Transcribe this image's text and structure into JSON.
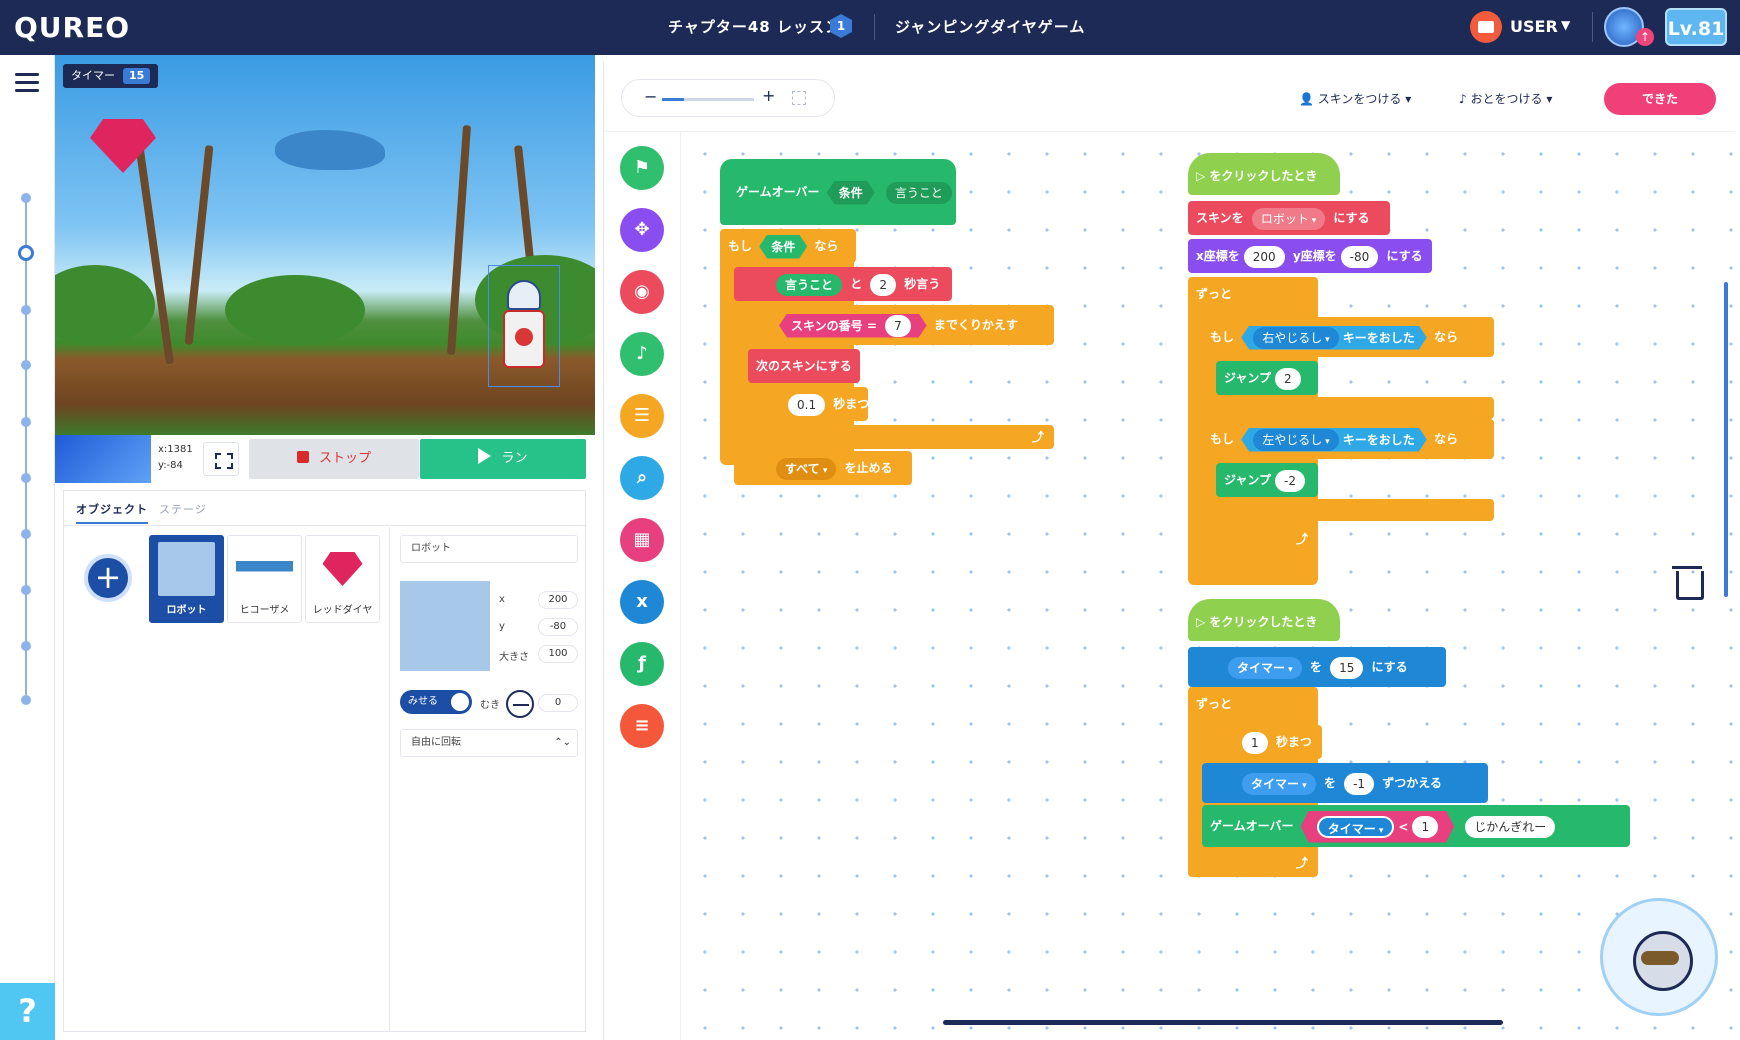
{
  "header": {
    "logo": "QUREO",
    "lesson": "チャプター48 レッスン",
    "lesson_badge": "1",
    "game_title": "ジャンピングダイヤゲーム",
    "user": "USER",
    "level": "Lv.81"
  },
  "stage": {
    "timer_label": "タイマー",
    "timer_value": "15",
    "coords_x": "x:1381",
    "coords_y": "y:-84",
    "stop_label": "ストップ",
    "run_label": "ラン"
  },
  "objects": {
    "tabs": [
      "オブジェクト",
      "ステージ"
    ],
    "items": [
      "ロボット",
      "ヒコーザメ",
      "レッドダイヤ"
    ],
    "selected": "ロボット",
    "props": {
      "name": "ロボット",
      "x_label": "x",
      "x": "200",
      "y_label": "y",
      "y": "-80",
      "size_label": "大きさ",
      "size": "100",
      "show_label": "みせる",
      "dir_label": "むき",
      "dir": "0",
      "rotation": "自由に回転"
    }
  },
  "editor": {
    "zoom_minus": "−",
    "zoom_plus": "+",
    "skin_menu": "スキンをつける",
    "sound_menu": "おとをつける",
    "done": "できた"
  },
  "palette": [
    {
      "icon": "flag-icon",
      "color": "#2fbf6f"
    },
    {
      "icon": "move-icon",
      "color": "#8a4df0"
    },
    {
      "icon": "look-icon",
      "color": "#ec4a5d"
    },
    {
      "icon": "music-icon",
      "color": "#2fbf6f"
    },
    {
      "icon": "control-icon",
      "color": "#f5a623"
    },
    {
      "icon": "search-icon",
      "color": "#2ea9e6"
    },
    {
      "icon": "calc-icon",
      "color": "#e8407e"
    },
    {
      "icon": "variable-icon",
      "color": "#1e88d6"
    },
    {
      "icon": "function-icon",
      "color": "#26b86b"
    },
    {
      "icon": "list-icon",
      "color": "#f5573a"
    }
  ],
  "blocks": {
    "def": {
      "name": "ゲームオーバー",
      "p1": "条件",
      "p2": "言うこと"
    },
    "if1": {
      "kw": "もし",
      "cond": "条件",
      "then": "なら"
    },
    "say": {
      "msg": "言うこと",
      "and": "と",
      "sec": "2",
      "suffix": "秒言う"
    },
    "repeat": {
      "var": "スキンの番号",
      "op": "=",
      "val": "7",
      "suffix": "までくりかえす"
    },
    "nextskin": "次のスキンにする",
    "wait1": {
      "val": "0.1",
      "suffix": "秒まつ"
    },
    "stop": {
      "target": "すべて",
      "suffix": "を止める"
    },
    "s1": {
      "hat": "をクリックしたとき",
      "skin": {
        "pre": "スキンを",
        "val": "ロボット",
        "suf": "にする"
      },
      "pos": {
        "xl": "x座標を",
        "x": "200",
        "yl": "y座標を",
        "y": "-80",
        "suf": "にする"
      },
      "forever": "ずっと",
      "if_kw": "もし",
      "then": "なら",
      "right": "右やじるし",
      "left": "左やじるし",
      "key": "キーをおした",
      "jump": "ジャンプ",
      "j1": "2",
      "j2": "-2"
    },
    "s2": {
      "hat": "をクリックしたとき",
      "var": "タイマー",
      "to": "を",
      "init": "15",
      "set": "にする",
      "forever": "ずっと",
      "wait": "1",
      "wait_suf": "秒まつ",
      "change_val": "-1",
      "change_suf": "ずつかえる",
      "gameover": "ゲームオーバー",
      "lt": "<",
      "cmp": "1",
      "msg": "じかんぎれー"
    }
  }
}
